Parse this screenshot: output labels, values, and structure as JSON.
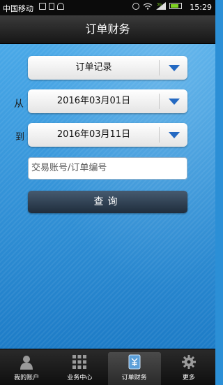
{
  "status_bar": {
    "carrier": "中国移动",
    "time": "15:29"
  },
  "header": {
    "title": "订单财务"
  },
  "form": {
    "record_type": "订单记录",
    "from_label": "从",
    "from_date": "2016年03月01日",
    "to_label": "到",
    "to_date": "2016年03月11日",
    "search_placeholder": "交易账号/订单编号",
    "query_label": "查询"
  },
  "nav": {
    "items": [
      {
        "label": "我的账户",
        "icon": "user-icon"
      },
      {
        "label": "业务中心",
        "icon": "grid-icon"
      },
      {
        "label": "订单财务",
        "icon": "finance-icon"
      },
      {
        "label": "更多",
        "icon": "gear-icon"
      }
    ],
    "active_index": 2
  },
  "colors": {
    "accent": "#2469c2",
    "background": "#2b8fd6",
    "button": "#2f3f50"
  }
}
